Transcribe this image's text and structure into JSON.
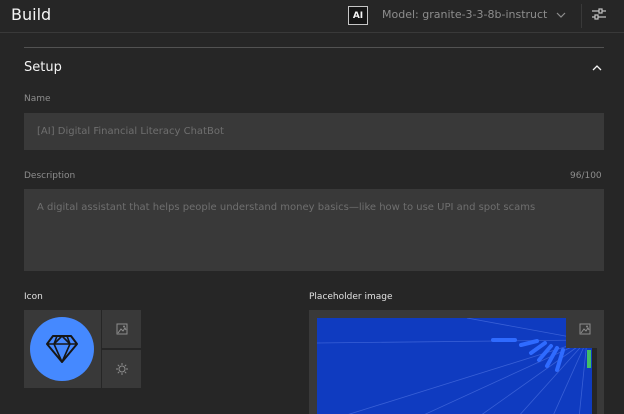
{
  "header": {
    "title": "Build",
    "ai_badge": "AI",
    "model_label": "Model: granite-3-3-8b-instruct"
  },
  "setup": {
    "title": "Setup",
    "name": {
      "label": "Name",
      "value": "[AI] Digital Financial Literacy ChatBot"
    },
    "description": {
      "label": "Description",
      "count": "96/100",
      "value": "A digital assistant that helps people understand money basics—like how to use UPI and spot scams"
    },
    "icon": {
      "label": "Icon",
      "glyph": "diamond-icon",
      "circle_color": "#4589ff"
    },
    "placeholder_image": {
      "label": "Placeholder image",
      "background_color": "#0f3bc0"
    }
  }
}
